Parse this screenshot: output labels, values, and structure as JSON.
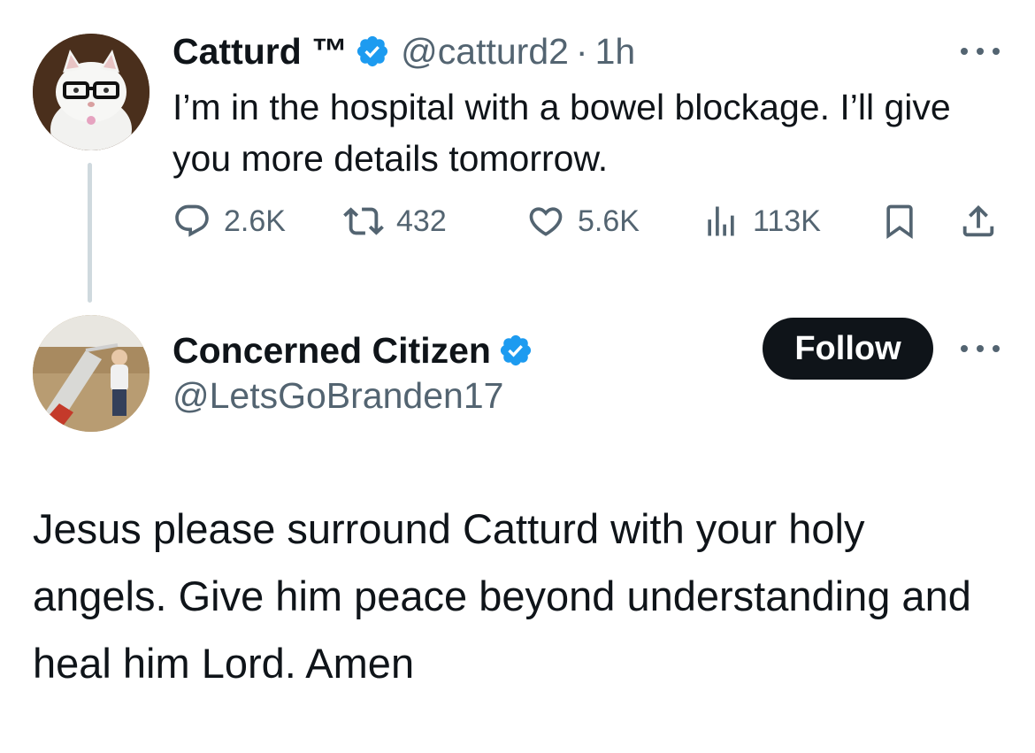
{
  "tweet1": {
    "name": "Catturd ™",
    "handle": "@catturd2",
    "separator": "·",
    "time": "1h",
    "text": "I’m in the hospital with a bowel blockage. I’ll give you more details tomorrow.",
    "replies": "2.6K",
    "retweets": "432",
    "likes": "5.6K",
    "views": "113K"
  },
  "tweet2": {
    "name": "Concerned Citizen",
    "handle": "@LetsGoBranden17",
    "follow_label": "Follow",
    "text": "Jesus please surround Catturd with your holy angels.  Give him peace beyond understanding and heal him Lord. Amen"
  },
  "colors": {
    "verified": "#1d9bf0",
    "secondary_text": "#536471",
    "primary_text": "#0f1419",
    "thread_line": "#cfd9de"
  },
  "icons": [
    "reply-icon",
    "retweet-icon",
    "like-icon",
    "views-icon",
    "bookmark-icon",
    "share-icon",
    "more-icon",
    "verified-badge-icon"
  ]
}
